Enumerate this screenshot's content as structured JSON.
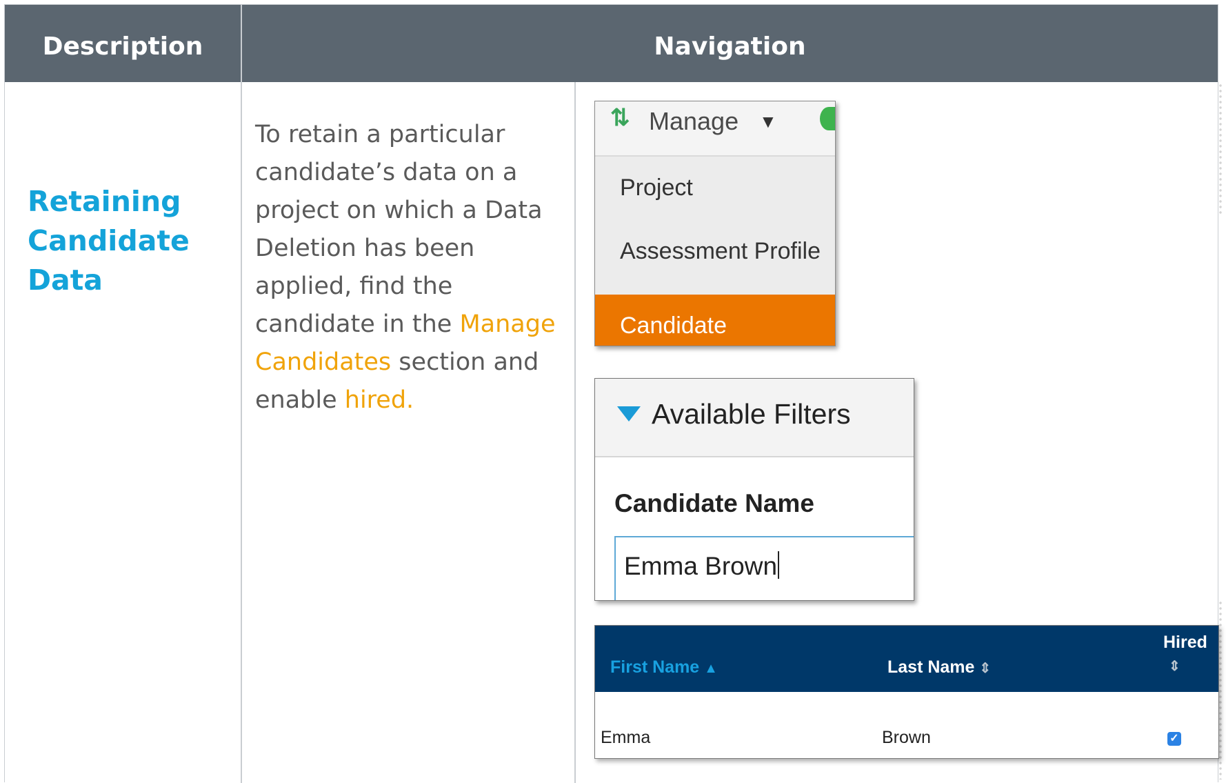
{
  "header": {
    "description_label": "Description",
    "navigation_label": "Navigation"
  },
  "row": {
    "title": "Retaining Candidate Data",
    "text_before": "To retain a particular candidate’s data on a project on which a Data Deletion has been applied, find the candidate in the ",
    "link_manage": "Manage Candidates",
    "text_middle": " section and enable ",
    "link_hired": "hired."
  },
  "manage_menu": {
    "label": "Manage",
    "icon": "move-arrows-icon",
    "items": [
      "Project",
      "Assessment Profile",
      "Candidate"
    ],
    "active_item": "Candidate",
    "active_color": "#eb7600"
  },
  "filters": {
    "title": "Available Filters",
    "field_label": "Candidate Name",
    "field_value": "Emma Brown"
  },
  "candidates_table": {
    "columns": [
      "First Name",
      "Last Name",
      "Hired"
    ],
    "rows": [
      {
        "first_name": "Emma",
        "last_name": "Brown",
        "hired": true
      }
    ]
  }
}
